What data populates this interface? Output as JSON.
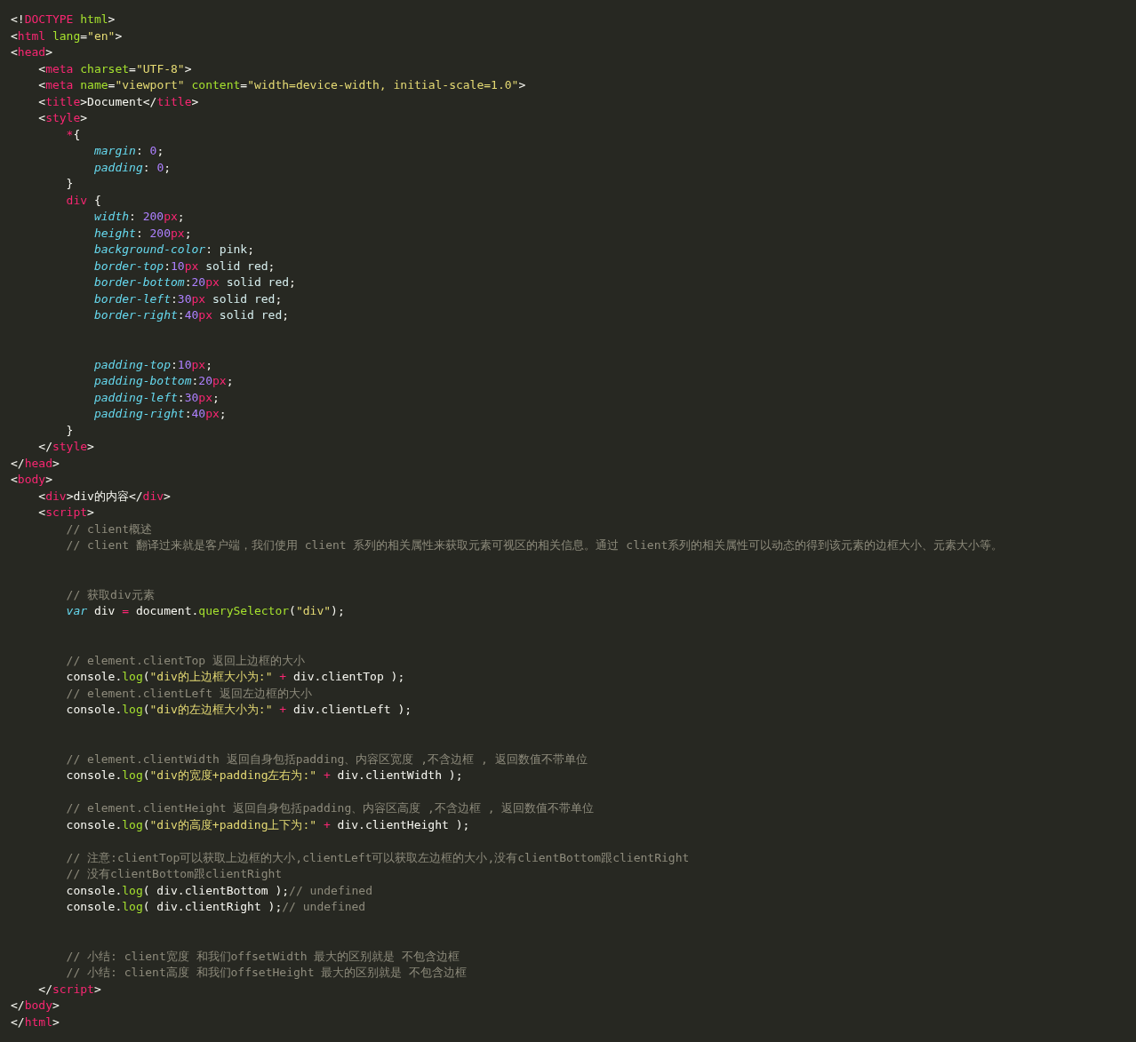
{
  "editor": {
    "lines": [
      {
        "kind": "code",
        "tokens": [
          {
            "kind": "punct",
            "text": "<!"
          },
          {
            "kind": "tag",
            "text": "DOCTYPE"
          },
          {
            "kind": "attr",
            "text": " html"
          },
          {
            "kind": "punct",
            "text": ">"
          }
        ]
      },
      {
        "kind": "code",
        "tokens": [
          {
            "kind": "punct",
            "text": "<"
          },
          {
            "kind": "tag",
            "text": "html"
          },
          {
            "kind": "attr",
            "text": " lang"
          },
          {
            "kind": "punct",
            "text": "="
          },
          {
            "kind": "string",
            "text": "\"en\""
          },
          {
            "kind": "punct",
            "text": ">"
          }
        ]
      },
      {
        "kind": "code",
        "tokens": [
          {
            "kind": "punct",
            "text": "<"
          },
          {
            "kind": "tag",
            "text": "head"
          },
          {
            "kind": "punct",
            "text": ">"
          }
        ]
      },
      {
        "kind": "code",
        "tokens": [
          {
            "kind": "punct",
            "text": "    <"
          },
          {
            "kind": "tag",
            "text": "meta"
          },
          {
            "kind": "attr",
            "text": " charset"
          },
          {
            "kind": "punct",
            "text": "="
          },
          {
            "kind": "string",
            "text": "\"UTF-8\""
          },
          {
            "kind": "punct",
            "text": ">"
          }
        ]
      },
      {
        "kind": "code",
        "tokens": [
          {
            "kind": "punct",
            "text": "    <"
          },
          {
            "kind": "tag",
            "text": "meta"
          },
          {
            "kind": "attr",
            "text": " name"
          },
          {
            "kind": "punct",
            "text": "="
          },
          {
            "kind": "string",
            "text": "\"viewport\""
          },
          {
            "kind": "attr",
            "text": " content"
          },
          {
            "kind": "punct",
            "text": "="
          },
          {
            "kind": "string",
            "text": "\"width=device-width, initial-scale=1.0\""
          },
          {
            "kind": "punct",
            "text": ">"
          }
        ]
      },
      {
        "kind": "code",
        "tokens": [
          {
            "kind": "punct",
            "text": "    <"
          },
          {
            "kind": "tag",
            "text": "title"
          },
          {
            "kind": "punct",
            "text": ">Document</"
          },
          {
            "kind": "tag",
            "text": "title"
          },
          {
            "kind": "punct",
            "text": ">"
          }
        ]
      },
      {
        "kind": "code",
        "tokens": [
          {
            "kind": "punct",
            "text": "    <"
          },
          {
            "kind": "tag",
            "text": "style"
          },
          {
            "kind": "punct",
            "text": ">"
          }
        ]
      },
      {
        "kind": "code",
        "tokens": [
          {
            "kind": "tag",
            "text": "        *"
          },
          {
            "kind": "punct",
            "text": "{"
          }
        ]
      },
      {
        "kind": "code",
        "tokens": [
          {
            "kind": "prop",
            "text": "            margin"
          },
          {
            "kind": "punct",
            "text": ": "
          },
          {
            "kind": "num",
            "text": "0"
          },
          {
            "kind": "punct",
            "text": ";"
          }
        ]
      },
      {
        "kind": "code",
        "tokens": [
          {
            "kind": "prop",
            "text": "            padding"
          },
          {
            "kind": "punct",
            "text": ": "
          },
          {
            "kind": "num",
            "text": "0"
          },
          {
            "kind": "punct",
            "text": ";"
          }
        ]
      },
      {
        "kind": "code",
        "tokens": [
          {
            "kind": "punct",
            "text": "        }"
          }
        ]
      },
      {
        "kind": "code",
        "tokens": [
          {
            "kind": "tag",
            "text": "        div"
          },
          {
            "kind": "punct",
            "text": " {"
          }
        ]
      },
      {
        "kind": "code",
        "tokens": [
          {
            "kind": "prop",
            "text": "            width"
          },
          {
            "kind": "punct",
            "text": ": "
          },
          {
            "kind": "num",
            "text": "200"
          },
          {
            "kind": "unit",
            "text": "px"
          },
          {
            "kind": "punct",
            "text": ";"
          }
        ]
      },
      {
        "kind": "code",
        "tokens": [
          {
            "kind": "prop",
            "text": "            height"
          },
          {
            "kind": "punct",
            "text": ": "
          },
          {
            "kind": "num",
            "text": "200"
          },
          {
            "kind": "unit",
            "text": "px"
          },
          {
            "kind": "punct",
            "text": ";"
          }
        ]
      },
      {
        "kind": "code",
        "tokens": [
          {
            "kind": "prop",
            "text": "            background-color"
          },
          {
            "kind": "punct",
            "text": ": "
          },
          {
            "kind": "value",
            "text": "pink"
          },
          {
            "kind": "punct",
            "text": ";"
          }
        ]
      },
      {
        "kind": "code",
        "tokens": [
          {
            "kind": "prop",
            "text": "            border-top"
          },
          {
            "kind": "punct",
            "text": ":"
          },
          {
            "kind": "num",
            "text": "10"
          },
          {
            "kind": "unit",
            "text": "px"
          },
          {
            "kind": "value",
            "text": " solid red"
          },
          {
            "kind": "punct",
            "text": ";"
          }
        ]
      },
      {
        "kind": "code",
        "tokens": [
          {
            "kind": "prop",
            "text": "            border-bottom"
          },
          {
            "kind": "punct",
            "text": ":"
          },
          {
            "kind": "num",
            "text": "20"
          },
          {
            "kind": "unit",
            "text": "px"
          },
          {
            "kind": "value",
            "text": " solid red"
          },
          {
            "kind": "punct",
            "text": ";"
          }
        ]
      },
      {
        "kind": "code",
        "tokens": [
          {
            "kind": "prop",
            "text": "            border-left"
          },
          {
            "kind": "punct",
            "text": ":"
          },
          {
            "kind": "num",
            "text": "30"
          },
          {
            "kind": "unit",
            "text": "px"
          },
          {
            "kind": "value",
            "text": " solid red"
          },
          {
            "kind": "punct",
            "text": ";"
          }
        ]
      },
      {
        "kind": "code",
        "tokens": [
          {
            "kind": "prop",
            "text": "            border-right"
          },
          {
            "kind": "punct",
            "text": ":"
          },
          {
            "kind": "num",
            "text": "40"
          },
          {
            "kind": "unit",
            "text": "px"
          },
          {
            "kind": "value",
            "text": " solid red"
          },
          {
            "kind": "punct",
            "text": ";"
          }
        ]
      },
      {
        "kind": "blank"
      },
      {
        "kind": "blank"
      },
      {
        "kind": "code",
        "tokens": [
          {
            "kind": "prop",
            "text": "            padding-top"
          },
          {
            "kind": "punct",
            "text": ":"
          },
          {
            "kind": "num",
            "text": "10"
          },
          {
            "kind": "unit",
            "text": "px"
          },
          {
            "kind": "punct",
            "text": ";"
          }
        ]
      },
      {
        "kind": "code",
        "tokens": [
          {
            "kind": "prop",
            "text": "            padding-bottom"
          },
          {
            "kind": "punct",
            "text": ":"
          },
          {
            "kind": "num",
            "text": "20"
          },
          {
            "kind": "unit",
            "text": "px"
          },
          {
            "kind": "punct",
            "text": ";"
          }
        ]
      },
      {
        "kind": "code",
        "tokens": [
          {
            "kind": "prop",
            "text": "            padding-left"
          },
          {
            "kind": "punct",
            "text": ":"
          },
          {
            "kind": "num",
            "text": "30"
          },
          {
            "kind": "unit",
            "text": "px"
          },
          {
            "kind": "punct",
            "text": ";"
          }
        ]
      },
      {
        "kind": "code",
        "tokens": [
          {
            "kind": "prop",
            "text": "            padding-right"
          },
          {
            "kind": "punct",
            "text": ":"
          },
          {
            "kind": "num",
            "text": "40"
          },
          {
            "kind": "unit",
            "text": "px"
          },
          {
            "kind": "punct",
            "text": ";"
          }
        ]
      },
      {
        "kind": "code",
        "tokens": [
          {
            "kind": "punct",
            "text": "        }"
          }
        ]
      },
      {
        "kind": "code",
        "tokens": [
          {
            "kind": "punct",
            "text": "    </"
          },
          {
            "kind": "tag",
            "text": "style"
          },
          {
            "kind": "punct",
            "text": ">"
          }
        ]
      },
      {
        "kind": "code",
        "tokens": [
          {
            "kind": "punct",
            "text": "</"
          },
          {
            "kind": "tag",
            "text": "head"
          },
          {
            "kind": "punct",
            "text": ">"
          }
        ]
      },
      {
        "kind": "code",
        "tokens": [
          {
            "kind": "punct",
            "text": "<"
          },
          {
            "kind": "tag",
            "text": "body"
          },
          {
            "kind": "punct",
            "text": ">"
          }
        ]
      },
      {
        "kind": "code",
        "tokens": [
          {
            "kind": "punct",
            "text": "    <"
          },
          {
            "kind": "tag",
            "text": "div"
          },
          {
            "kind": "punct",
            "text": ">div的内容</"
          },
          {
            "kind": "tag",
            "text": "div"
          },
          {
            "kind": "punct",
            "text": ">"
          }
        ]
      },
      {
        "kind": "code",
        "tokens": [
          {
            "kind": "punct",
            "text": "    <"
          },
          {
            "kind": "tag",
            "text": "script"
          },
          {
            "kind": "punct",
            "text": ">"
          }
        ]
      },
      {
        "kind": "code",
        "tokens": [
          {
            "kind": "comment",
            "text": "        // client概述"
          }
        ]
      },
      {
        "kind": "code",
        "tokens": [
          {
            "kind": "comment",
            "text": "        // client 翻译过来就是客户端，我们使用 client 系列的相关属性来获取元素可视区的相关信息。通过 client系列的相关属性可以动态的得到该元素的边框大小、元素大小等。"
          }
        ]
      },
      {
        "kind": "blank"
      },
      {
        "kind": "blank"
      },
      {
        "kind": "code",
        "tokens": [
          {
            "kind": "comment",
            "text": "        // 获取div元素"
          }
        ]
      },
      {
        "kind": "code",
        "tokens": [
          {
            "kind": "keyword",
            "text": "        var"
          },
          {
            "kind": "punct",
            "text": " div "
          },
          {
            "kind": "op",
            "text": "="
          },
          {
            "kind": "punct",
            "text": " document."
          },
          {
            "kind": "func",
            "text": "querySelector"
          },
          {
            "kind": "punct",
            "text": "("
          },
          {
            "kind": "string",
            "text": "\"div\""
          },
          {
            "kind": "punct",
            "text": ");"
          }
        ]
      },
      {
        "kind": "blank"
      },
      {
        "kind": "blank"
      },
      {
        "kind": "code",
        "tokens": [
          {
            "kind": "comment",
            "text": "        // element.clientTop 返回上边框的大小"
          }
        ]
      },
      {
        "kind": "code",
        "tokens": [
          {
            "kind": "punct",
            "text": "        console."
          },
          {
            "kind": "func",
            "text": "log"
          },
          {
            "kind": "punct",
            "text": "("
          },
          {
            "kind": "string",
            "text": "\"div的上边框大小为:\""
          },
          {
            "kind": "op",
            "text": " +"
          },
          {
            "kind": "punct",
            "text": " div.clientTop );"
          }
        ]
      },
      {
        "kind": "code",
        "tokens": [
          {
            "kind": "comment",
            "text": "        // element.clientLeft 返回左边框的大小"
          }
        ]
      },
      {
        "kind": "code",
        "tokens": [
          {
            "kind": "punct",
            "text": "        console."
          },
          {
            "kind": "func",
            "text": "log"
          },
          {
            "kind": "punct",
            "text": "("
          },
          {
            "kind": "string",
            "text": "\"div的左边框大小为:\""
          },
          {
            "kind": "op",
            "text": " +"
          },
          {
            "kind": "punct",
            "text": " div.clientLeft );"
          }
        ]
      },
      {
        "kind": "blank"
      },
      {
        "kind": "blank"
      },
      {
        "kind": "code",
        "tokens": [
          {
            "kind": "comment",
            "text": "        // element.clientWidth 返回自身包括padding、内容区宽度 ,不含边框 , 返回数值不带单位"
          }
        ]
      },
      {
        "kind": "code",
        "tokens": [
          {
            "kind": "punct",
            "text": "        console."
          },
          {
            "kind": "func",
            "text": "log"
          },
          {
            "kind": "punct",
            "text": "("
          },
          {
            "kind": "string",
            "text": "\"div的宽度+padding左右为:\""
          },
          {
            "kind": "op",
            "text": " +"
          },
          {
            "kind": "punct",
            "text": " div.clientWidth );"
          }
        ]
      },
      {
        "kind": "blank"
      },
      {
        "kind": "code",
        "tokens": [
          {
            "kind": "comment",
            "text": "        // element.clientHeight 返回自身包括padding、内容区高度 ,不含边框 , 返回数值不带单位"
          }
        ]
      },
      {
        "kind": "code",
        "tokens": [
          {
            "kind": "punct",
            "text": "        console."
          },
          {
            "kind": "func",
            "text": "log"
          },
          {
            "kind": "punct",
            "text": "("
          },
          {
            "kind": "string",
            "text": "\"div的高度+padding上下为:\""
          },
          {
            "kind": "op",
            "text": " +"
          },
          {
            "kind": "punct",
            "text": " div.clientHeight );"
          }
        ]
      },
      {
        "kind": "blank"
      },
      {
        "kind": "code",
        "tokens": [
          {
            "kind": "comment",
            "text": "        // 注意:clientTop可以获取上边框的大小,clientLeft可以获取左边框的大小,没有clientBottom跟clientRight"
          }
        ]
      },
      {
        "kind": "code",
        "tokens": [
          {
            "kind": "comment",
            "text": "        // 没有clientBottom跟clientRight"
          }
        ]
      },
      {
        "kind": "code",
        "tokens": [
          {
            "kind": "punct",
            "text": "        console."
          },
          {
            "kind": "func",
            "text": "log"
          },
          {
            "kind": "punct",
            "text": "( div.clientBottom );"
          },
          {
            "kind": "comment",
            "text": "// undefined"
          }
        ]
      },
      {
        "kind": "code",
        "tokens": [
          {
            "kind": "punct",
            "text": "        console."
          },
          {
            "kind": "func",
            "text": "log"
          },
          {
            "kind": "punct",
            "text": "( div.clientRight );"
          },
          {
            "kind": "comment",
            "text": "// undefined"
          }
        ]
      },
      {
        "kind": "blank"
      },
      {
        "kind": "blank"
      },
      {
        "kind": "code",
        "tokens": [
          {
            "kind": "comment",
            "text": "        // 小结: client宽度 和我们offsetWidth 最大的区别就是 不包含边框"
          }
        ]
      },
      {
        "kind": "code",
        "tokens": [
          {
            "kind": "comment",
            "text": "        // 小结: client高度 和我们offsetHeight 最大的区别就是 不包含边框"
          }
        ]
      },
      {
        "kind": "code",
        "tokens": [
          {
            "kind": "punct",
            "text": "    </"
          },
          {
            "kind": "tag",
            "text": "script"
          },
          {
            "kind": "punct",
            "text": ">"
          }
        ]
      },
      {
        "kind": "code",
        "tokens": [
          {
            "kind": "punct",
            "text": "</"
          },
          {
            "kind": "tag",
            "text": "body"
          },
          {
            "kind": "punct",
            "text": ">"
          }
        ]
      },
      {
        "kind": "code",
        "tokens": [
          {
            "kind": "punct",
            "text": "</"
          },
          {
            "kind": "tag",
            "text": "html"
          },
          {
            "kind": "punct",
            "text": ">"
          }
        ]
      }
    ]
  }
}
